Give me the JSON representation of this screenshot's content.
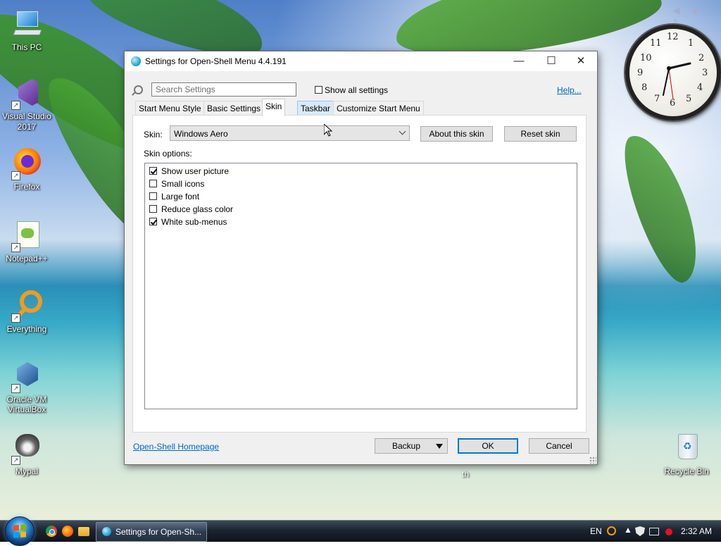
{
  "desktop": {
    "icons": [
      {
        "label": "This PC",
        "icon": "computer-icon"
      },
      {
        "label": "Visual Studio 2017",
        "icon": "visual-studio-icon"
      },
      {
        "label": "Firefox",
        "icon": "firefox-icon"
      },
      {
        "label": "Notepad++",
        "icon": "notepadpp-icon"
      },
      {
        "label": "Everything",
        "icon": "everything-search-icon"
      },
      {
        "label": "Oracle VM VirtualBox",
        "icon": "virtualbox-icon"
      },
      {
        "label": "Mypal",
        "icon": "mypal-icon"
      },
      {
        "label": "Recycle Bin",
        "icon": "recycle-bin-icon"
      }
    ],
    "stray_label": "th",
    "clock_numbers": [
      "12",
      "1",
      "2",
      "3",
      "4",
      "5",
      "6",
      "7",
      "8",
      "9",
      "10",
      "11"
    ],
    "gadget_nav": "◀ ▶ +"
  },
  "window": {
    "title": "Settings for Open-Shell Menu 4.4.191",
    "controls": {
      "minimize": "—",
      "maximize": "☐",
      "close": "✕"
    },
    "search_placeholder": "Search Settings",
    "show_all_label": "Show all settings",
    "show_all_checked": false,
    "help_label": "Help...",
    "tabs": [
      {
        "label": "Start Menu Style"
      },
      {
        "label": "Basic Settings"
      },
      {
        "label": "Skin",
        "active": true
      },
      {
        "label": "Taskbar",
        "hover": true
      },
      {
        "label": "Customize Start Menu"
      }
    ],
    "skin_label": "Skin:",
    "skin_value": "Windows Aero",
    "about_skin_label": "About this skin",
    "reset_skin_label": "Reset skin",
    "skin_options_label": "Skin options:",
    "options": [
      {
        "label": "Show user picture",
        "checked": true
      },
      {
        "label": "Small icons",
        "checked": false
      },
      {
        "label": "Large font",
        "checked": false
      },
      {
        "label": "Reduce glass color",
        "checked": false
      },
      {
        "label": "White sub-menus",
        "checked": true
      }
    ],
    "homepage_link": "Open-Shell Homepage",
    "backup_label": "Backup",
    "ok_label": "OK",
    "cancel_label": "Cancel"
  },
  "taskbar": {
    "task_title": "Settings for Open-Sh...",
    "language": "EN",
    "time": "2:32 AM",
    "up_arrow": "▲"
  },
  "colors": {
    "link": "#0066cc",
    "ok_border": "#0078d7"
  }
}
